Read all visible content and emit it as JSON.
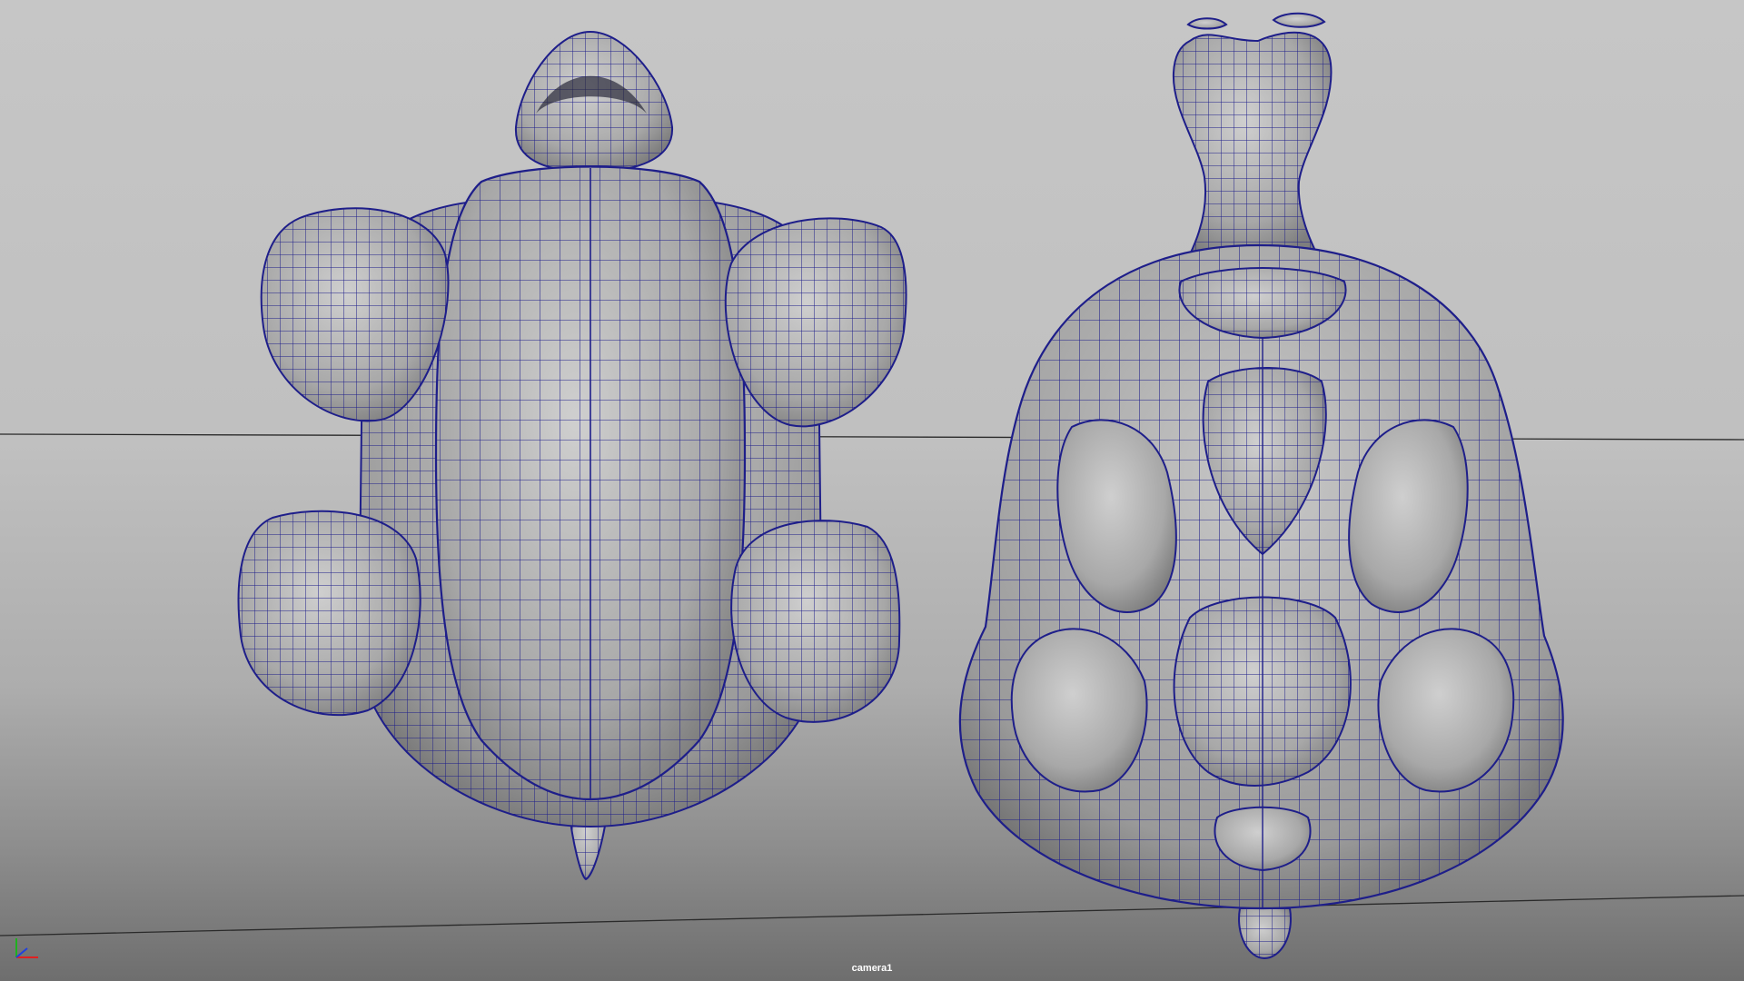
{
  "viewport": {
    "camera_label": "camera1"
  },
  "axis_gizmo": {
    "colors": {
      "x": "#e02020",
      "y": "#20b020",
      "z": "#2040e0"
    }
  },
  "mesh": {
    "wire_color": "#1e1e8a",
    "surface_color": "#b4b4b4",
    "surface_shadow": "#8c8c8c",
    "models": [
      "turtle-bottom-view",
      "turtle-top-view"
    ]
  }
}
